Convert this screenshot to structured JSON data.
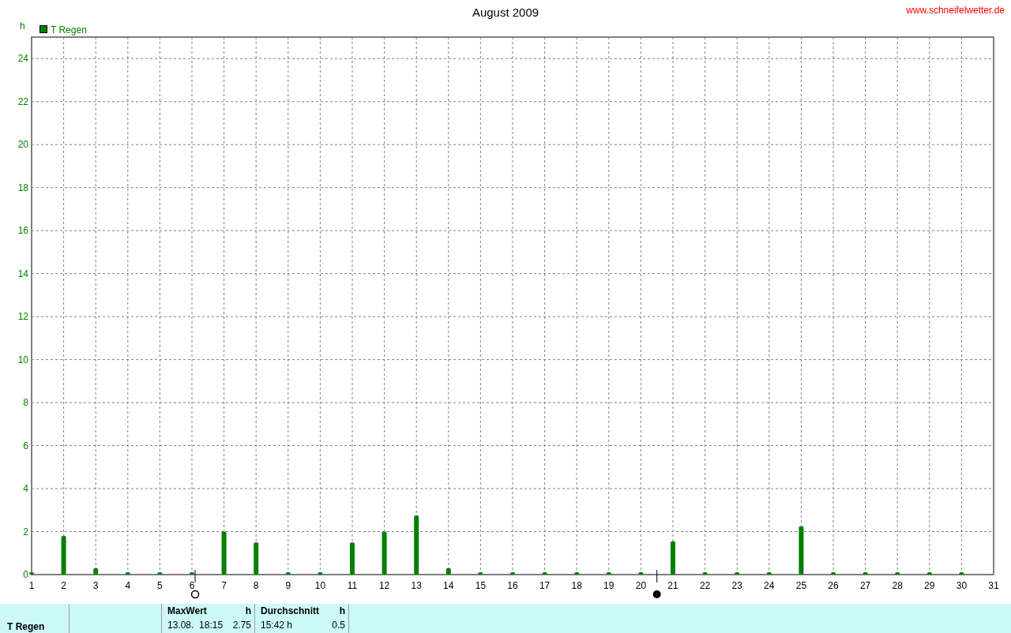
{
  "title": "August 2009",
  "site": "www.schneifelwetter.de",
  "chart": {
    "unit": "h",
    "moon_phases": [
      {
        "kind": "full"
      },
      {
        "kind": "new"
      }
    ],
    "chart_data": {
      "type": "bar",
      "x": [
        1,
        2,
        3,
        4,
        5,
        6,
        7,
        8,
        9,
        10,
        11,
        12,
        13,
        14,
        15,
        16,
        17,
        18,
        19,
        20,
        21,
        22,
        23,
        24,
        25,
        26,
        27,
        28,
        29,
        30
      ],
      "series": [
        {
          "name": "T Regen",
          "color": "#008000",
          "values": [
            0,
            1.8,
            0.3,
            0,
            0,
            0,
            2.0,
            1.5,
            0,
            0,
            1.5,
            2.0,
            2.75,
            0.3,
            0,
            0,
            0,
            0,
            0,
            0,
            1.55,
            0,
            0,
            0,
            2.25,
            0,
            0,
            0,
            0,
            0
          ]
        }
      ],
      "xlim": [
        1,
        31
      ],
      "ylim": [
        0,
        25
      ],
      "xticks": [
        1,
        2,
        3,
        4,
        5,
        6,
        7,
        8,
        9,
        10,
        11,
        12,
        13,
        14,
        15,
        16,
        17,
        18,
        19,
        20,
        21,
        22,
        23,
        24,
        25,
        26,
        27,
        28,
        29,
        30,
        31
      ],
      "yticks": [
        0,
        2,
        4,
        6,
        8,
        10,
        12,
        14,
        16,
        18,
        20,
        22,
        24
      ],
      "grid": true
    }
  },
  "summary": {
    "series_label": "T Regen",
    "blocks": [
      {
        "heading": "MaxWert",
        "unit": "h",
        "value_1": "13.08.  18:15",
        "value_2": "2.75"
      },
      {
        "heading": "Durchschnitt",
        "unit": "h",
        "value_1": "15:42 h",
        "value_2": "0.5"
      }
    ]
  }
}
